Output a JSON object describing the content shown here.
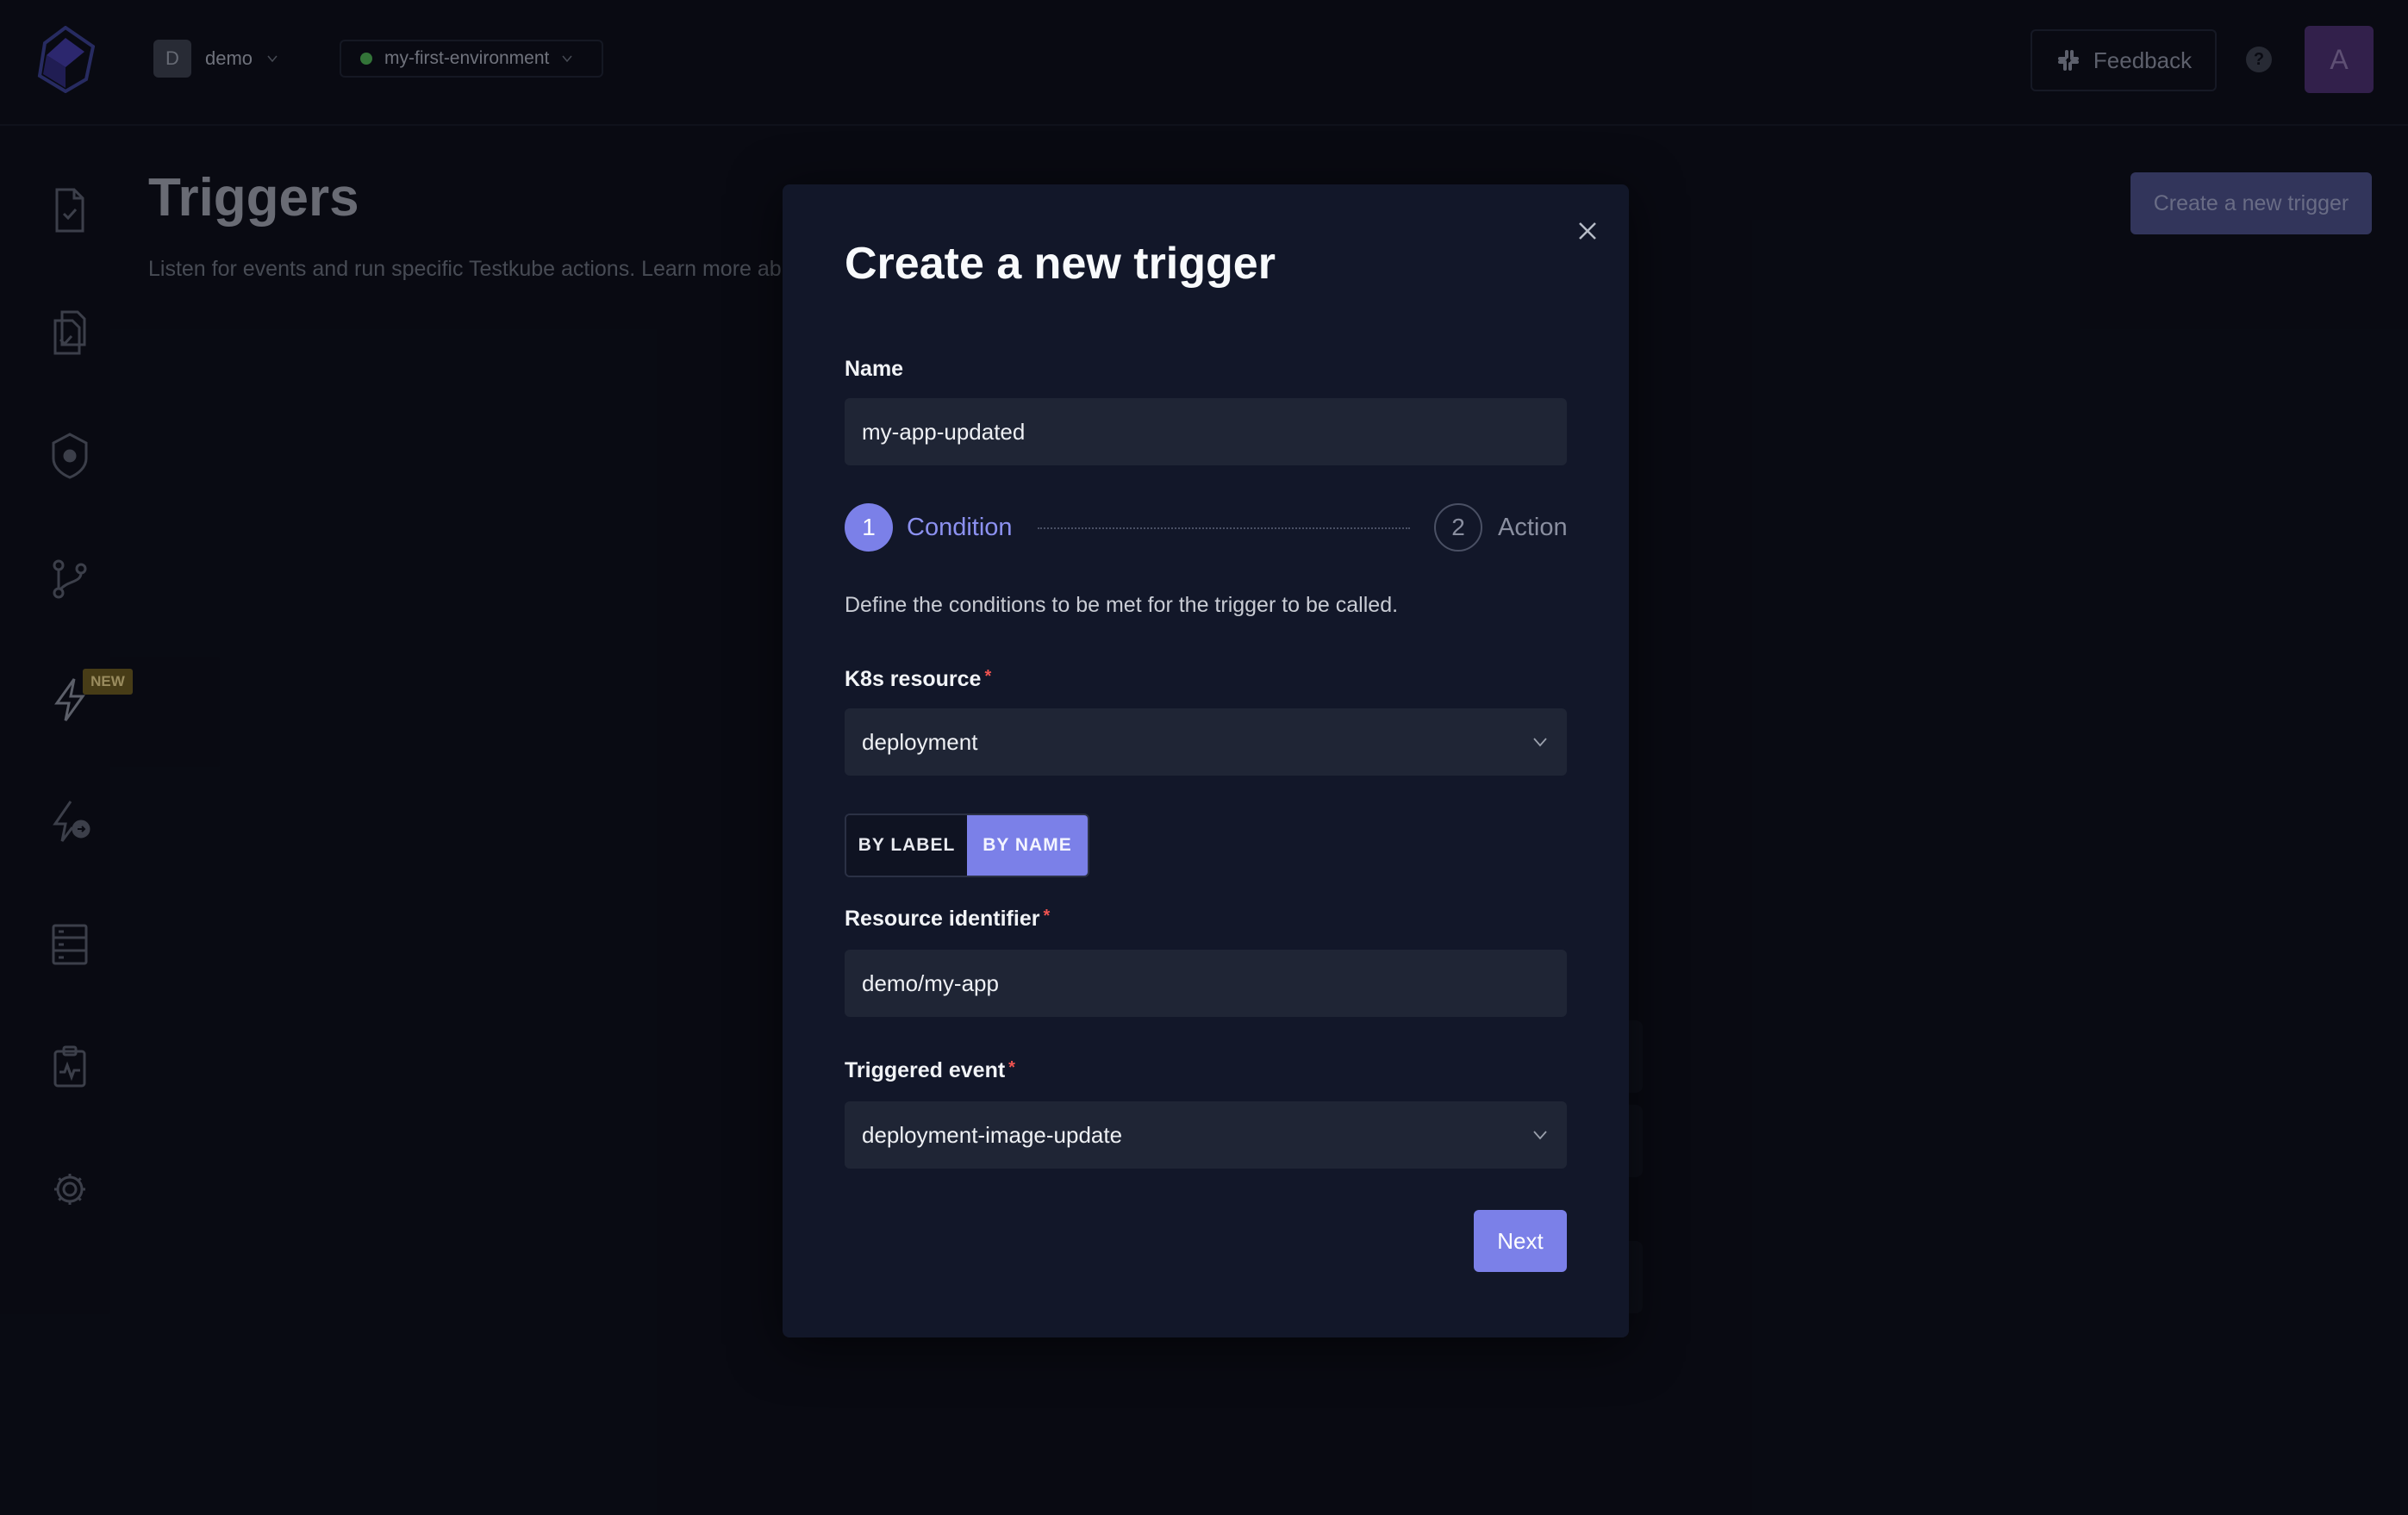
{
  "header": {
    "org_initial": "D",
    "org_name": "demo",
    "environment": "my-first-environment",
    "feedback_label": "Feedback",
    "help_glyph": "?",
    "avatar_initial": "A"
  },
  "sidebar": {
    "items": [
      {
        "icon": "file-check-icon"
      },
      {
        "icon": "files-check-icon"
      },
      {
        "icon": "shield-gear-icon"
      },
      {
        "icon": "workflow-branch-icon",
        "badge": "NEW"
      },
      {
        "icon": "lightning-icon"
      },
      {
        "icon": "lightning-arrow-icon"
      },
      {
        "icon": "server-icon"
      },
      {
        "icon": "clipboard-pulse-icon"
      },
      {
        "icon": "gear-icon"
      }
    ]
  },
  "page": {
    "title": "Triggers",
    "subtitle": "Listen for events and run specific Testkube actions. Learn more ab",
    "create_button": "Create a new trigger"
  },
  "modal": {
    "title": "Create a new trigger",
    "name_label": "Name",
    "name_value": "my-app-updated",
    "steps": [
      {
        "number": "1",
        "label": "Condition"
      },
      {
        "number": "2",
        "label": "Action"
      }
    ],
    "description": "Define the conditions to be met for the trigger to be called.",
    "required_mark": "*",
    "k8s_resource_label": "K8s resource",
    "k8s_resource_value": "deployment",
    "toggle": {
      "by_label": "BY LABEL",
      "by_name": "BY NAME",
      "selected": "BY NAME"
    },
    "resource_identifier_label": "Resource identifier",
    "resource_identifier_value": "demo/my-app",
    "triggered_event_label": "Triggered event",
    "triggered_event_value": "deployment-image-update",
    "next_button": "Next"
  },
  "colors": {
    "background": "#0b0d16",
    "modal": "#121729",
    "accent": "#7b80e8",
    "field": "#1f2535",
    "env_status": "#4caf50",
    "required": "#ef5350",
    "new_badge": "#6b5a1e"
  }
}
